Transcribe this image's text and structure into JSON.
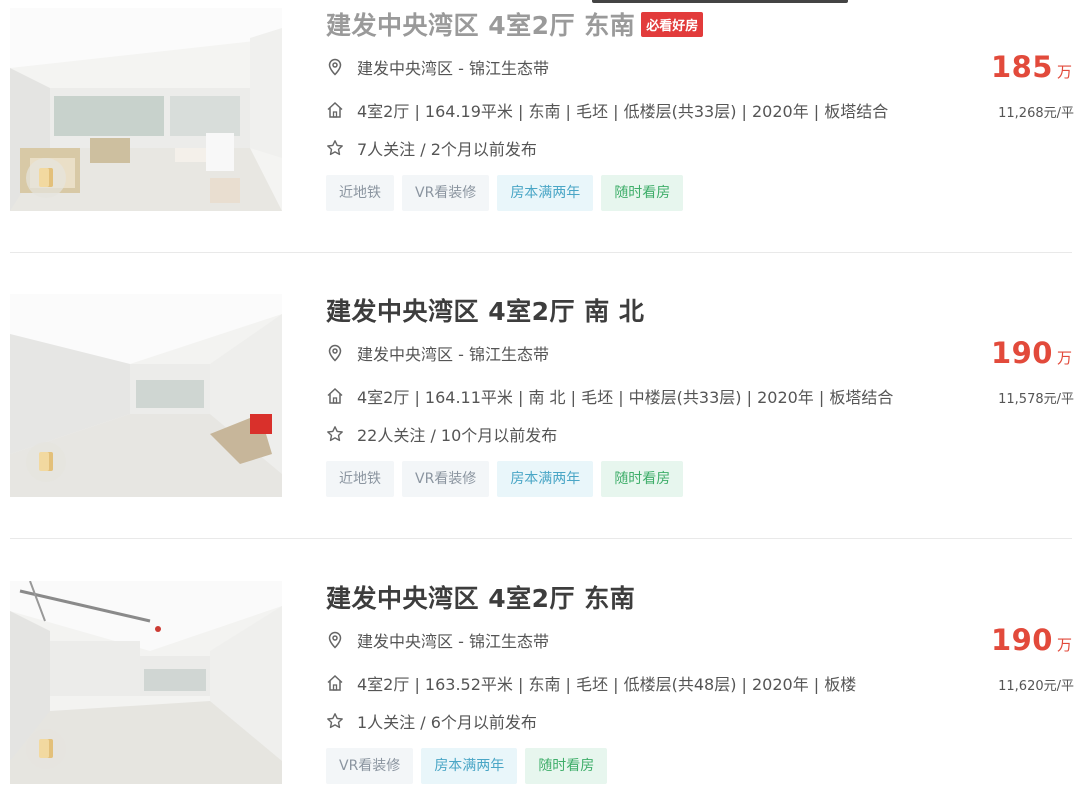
{
  "listings": [
    {
      "title": "建发中央湾区 4室2厅 东南",
      "badge": "必看好房",
      "location": "建发中央湾区 - 锦江生态带",
      "details": "4室2厅 | 164.19平米 | 东南 | 毛坯 | 低楼层(共33层) | 2020年 | 板塔结合",
      "follow": "7人关注 / 2个月以前发布",
      "tags": [
        {
          "label": "近地铁",
          "style": "gray"
        },
        {
          "label": "VR看装修",
          "style": "gray"
        },
        {
          "label": "房本满两年",
          "style": "blue"
        },
        {
          "label": "随时看房",
          "style": "green"
        }
      ],
      "price": "185",
      "price_unit": "万",
      "unit_price": "11,268元/平"
    },
    {
      "title": "建发中央湾区 4室2厅 南 北",
      "location": "建发中央湾区 - 锦江生态带",
      "details": "4室2厅 | 164.11平米 | 南 北 | 毛坯 | 中楼层(共33层) | 2020年 | 板塔结合",
      "follow": "22人关注 / 10个月以前发布",
      "tags": [
        {
          "label": "近地铁",
          "style": "gray"
        },
        {
          "label": "VR看装修",
          "style": "gray"
        },
        {
          "label": "房本满两年",
          "style": "blue"
        },
        {
          "label": "随时看房",
          "style": "green"
        }
      ],
      "price": "190",
      "price_unit": "万",
      "unit_price": "11,578元/平"
    },
    {
      "title": "建发中央湾区 4室2厅 东南",
      "location": "建发中央湾区 - 锦江生态带",
      "details": "4室2厅 | 163.52平米 | 东南 | 毛坯 | 低楼层(共48层) | 2020年 | 板楼",
      "follow": "1人关注 / 6个月以前发布",
      "tags": [
        {
          "label": "VR看装修",
          "style": "gray"
        },
        {
          "label": "房本满两年",
          "style": "blue"
        },
        {
          "label": "随时看房",
          "style": "green"
        }
      ],
      "price": "190",
      "price_unit": "万",
      "unit_price": "11,620元/平"
    }
  ],
  "icons": {
    "location": "location-pin-icon",
    "details": "house-icon",
    "follow": "star-icon",
    "vr": "vr-icon"
  },
  "colors": {
    "price": "#e24a3b",
    "badge": "#e23b3b",
    "tag_gray_text": "#8b95a0",
    "tag_blue_text": "#4aa6c6",
    "tag_green_text": "#3fae6a"
  }
}
